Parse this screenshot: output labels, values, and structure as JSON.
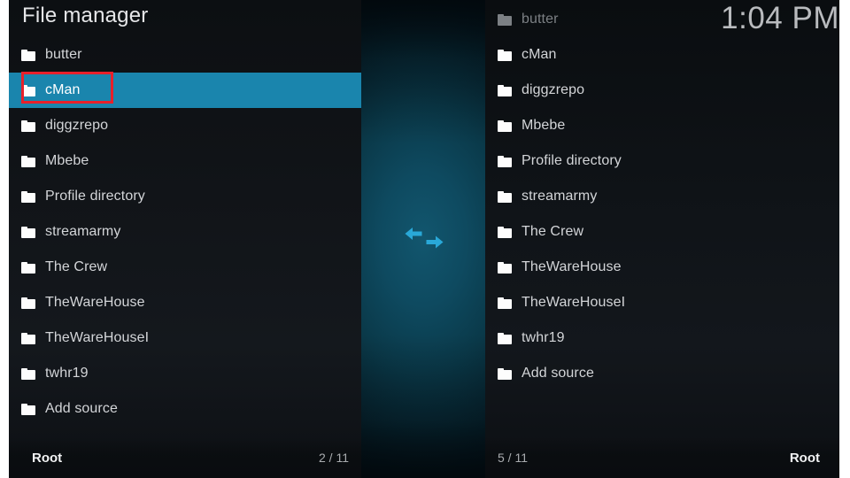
{
  "window": {
    "title": "File manager",
    "clock": "1:04 PM"
  },
  "colors": {
    "highlight": "#1a85ad",
    "annotation": "#e8202a",
    "center_band": "#0d4d63",
    "swap_arrow": "#29a8d8",
    "panel_background": "#0e1115",
    "text_primary": "#d3d5d8",
    "text_dimmed": "#7c8084"
  },
  "center": {
    "swap_icon_name": "swap-left-right-arrows-icon"
  },
  "left_panel": {
    "title": "File manager",
    "selected_index": 1,
    "items": [
      {
        "label": "butter",
        "icon": "folder-icon"
      },
      {
        "label": "cMan",
        "icon": "folder-icon"
      },
      {
        "label": "diggzrepo",
        "icon": "folder-icon"
      },
      {
        "label": "Mbebe",
        "icon": "folder-icon"
      },
      {
        "label": "Profile directory",
        "icon": "folder-icon"
      },
      {
        "label": "streamarmy",
        "icon": "folder-icon"
      },
      {
        "label": "The Crew",
        "icon": "folder-icon"
      },
      {
        "label": "TheWareHouse",
        "icon": "folder-icon"
      },
      {
        "label": "TheWareHouseI",
        "icon": "folder-icon"
      },
      {
        "label": "twhr19",
        "icon": "folder-icon"
      },
      {
        "label": "Add source",
        "icon": "folder-icon"
      }
    ],
    "status": {
      "path": "Root",
      "count": "2 / 11"
    }
  },
  "right_panel": {
    "dimmed_index": 0,
    "items": [
      {
        "label": "butter",
        "icon": "folder-icon"
      },
      {
        "label": "cMan",
        "icon": "folder-icon"
      },
      {
        "label": "diggzrepo",
        "icon": "folder-icon"
      },
      {
        "label": "Mbebe",
        "icon": "folder-icon"
      },
      {
        "label": "Profile directory",
        "icon": "folder-icon"
      },
      {
        "label": "streamarmy",
        "icon": "folder-icon"
      },
      {
        "label": "The Crew",
        "icon": "folder-icon"
      },
      {
        "label": "TheWareHouse",
        "icon": "folder-icon"
      },
      {
        "label": "TheWareHouseI",
        "icon": "folder-icon"
      },
      {
        "label": "twhr19",
        "icon": "folder-icon"
      },
      {
        "label": "Add source",
        "icon": "folder-icon"
      }
    ],
    "status": {
      "path": "Root",
      "count": "5 / 11"
    }
  }
}
